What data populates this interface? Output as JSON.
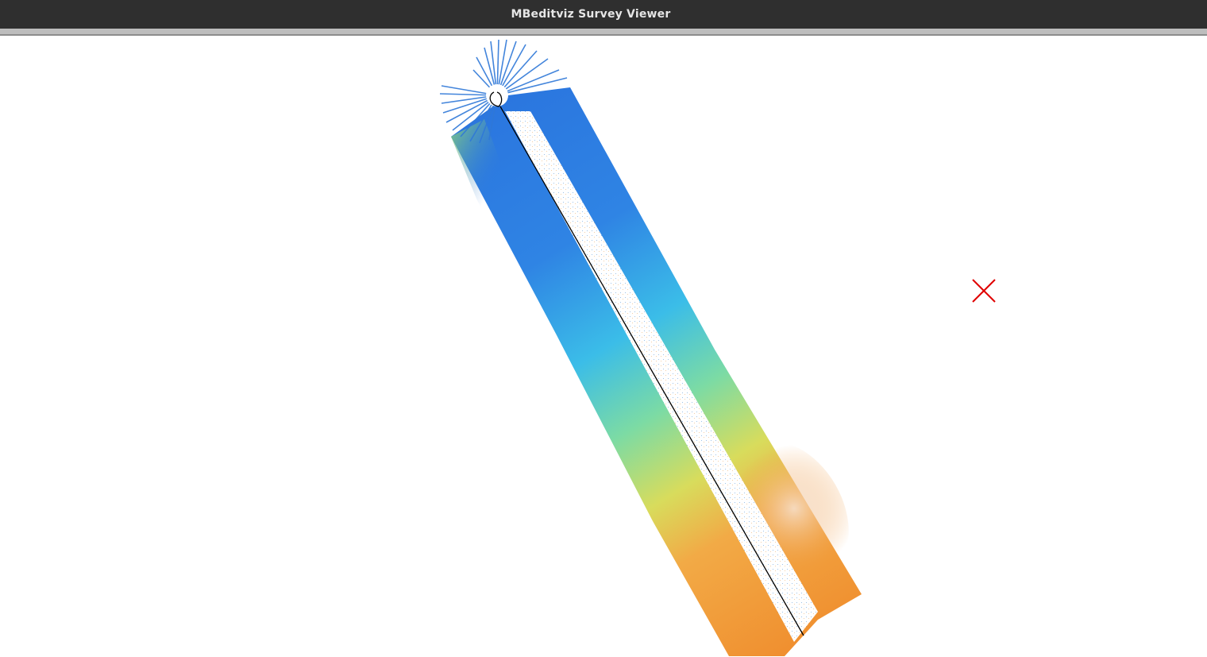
{
  "window": {
    "title": "MBeditviz Survey Viewer"
  },
  "viewer": {
    "background": "#ffffff",
    "cursor_marker_color": "#e00000",
    "navigation_track_color": "#000000",
    "colormap": [
      "#2f6fd8",
      "#2aa6e8",
      "#56d2de",
      "#86dc8c",
      "#e6dc5a",
      "#f0a040",
      "#ec9238",
      "#f0d8c8"
    ]
  },
  "icons": {
    "cursor_marker": "x-cross-icon"
  }
}
